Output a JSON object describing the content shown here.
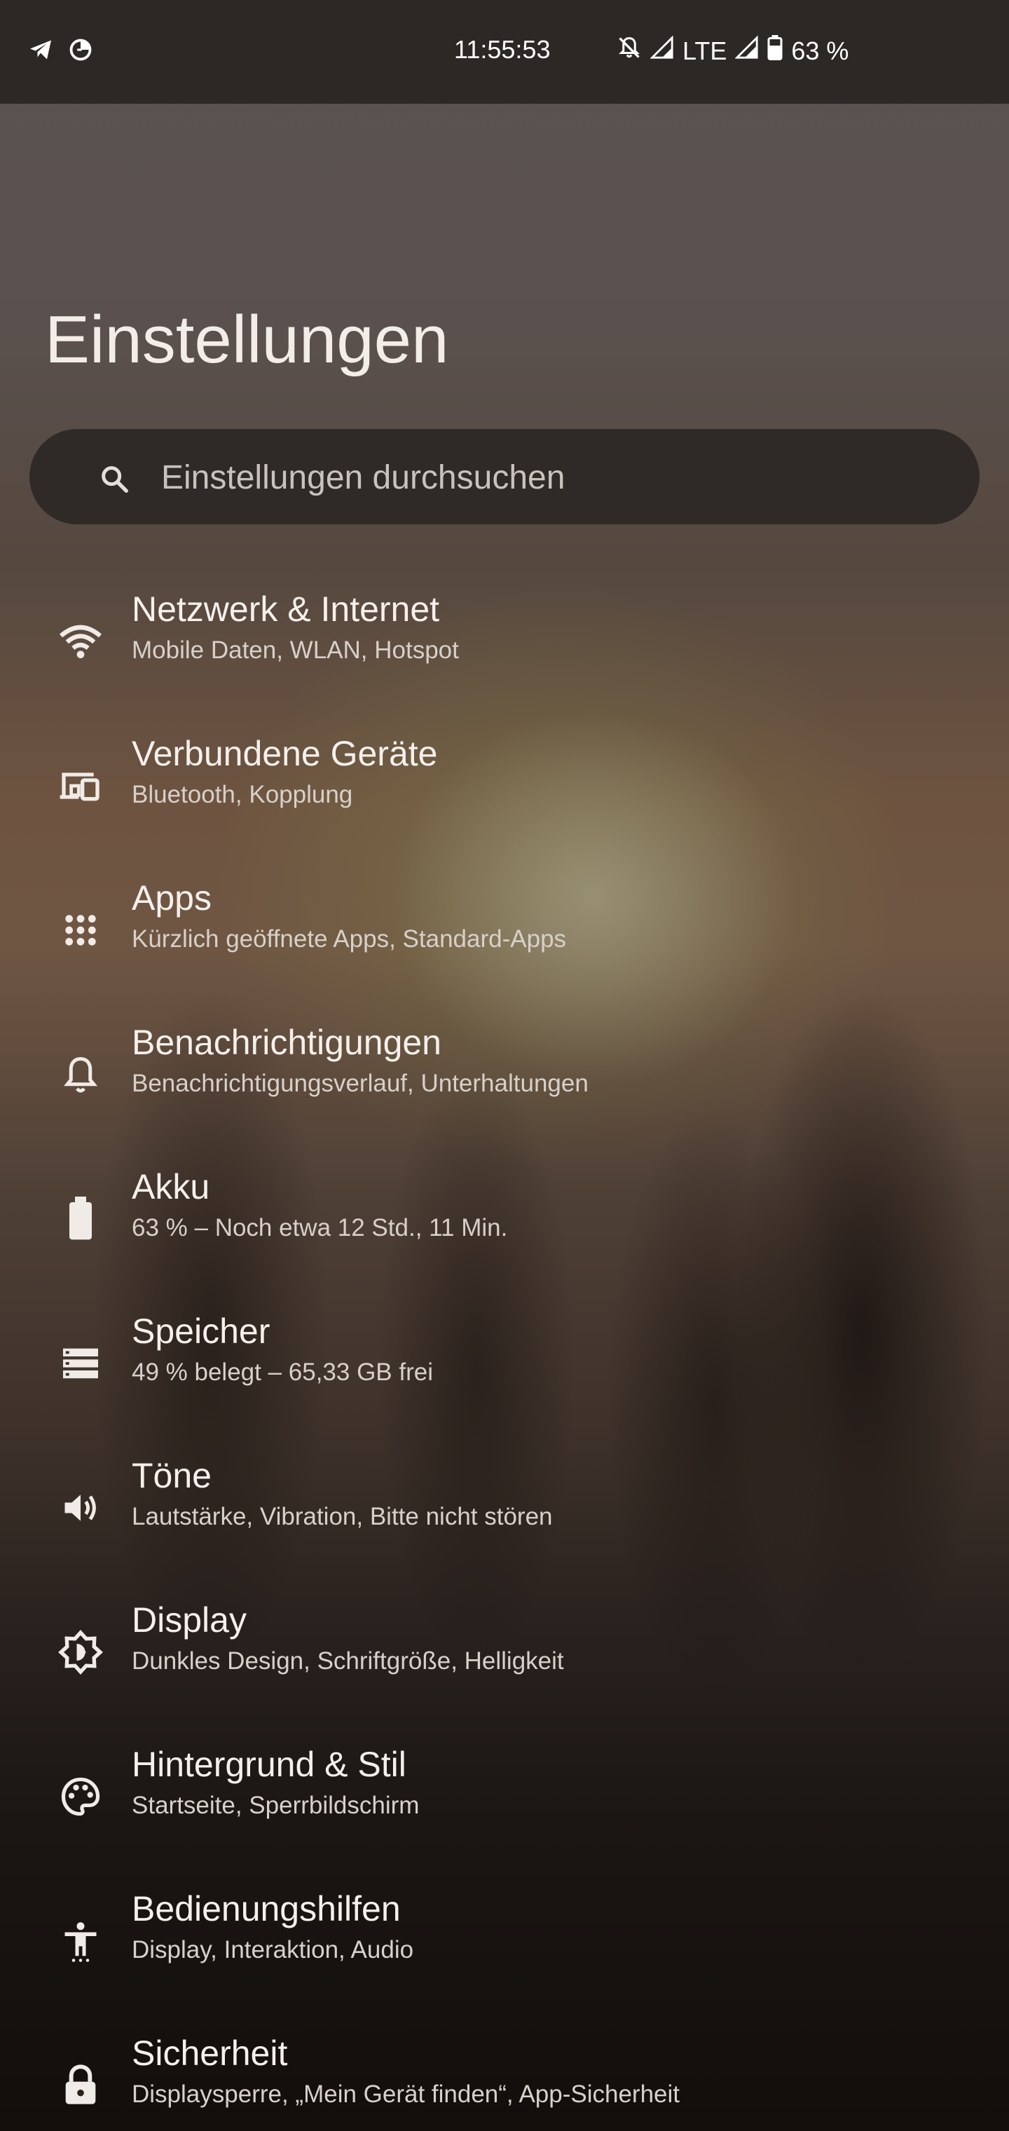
{
  "status_bar": {
    "time": "11:55:53",
    "network": "LTE",
    "battery": "63 %",
    "left_icons": [
      "telegram-icon",
      "data-saver-icon"
    ],
    "right_icons": [
      "bell-off-icon",
      "signal-icon",
      "signal-icon",
      "battery-icon"
    ]
  },
  "header": {
    "title": "Einstellungen"
  },
  "search": {
    "placeholder": "Einstellungen durchsuchen",
    "icon": "search-icon"
  },
  "settings": {
    "items": [
      {
        "title": "Netzwerk & Internet",
        "subtitle": "Mobile Daten, WLAN, Hotspot",
        "icon": "wifi-icon"
      },
      {
        "title": "Verbundene Geräte",
        "subtitle": "Bluetooth, Kopplung",
        "icon": "devices-icon"
      },
      {
        "title": "Apps",
        "subtitle": "Kürzlich geöffnete Apps, Standard-Apps",
        "icon": "apps-grid-icon"
      },
      {
        "title": "Benachrichtigungen",
        "subtitle": "Benachrichtigungsverlauf, Unterhaltungen",
        "icon": "bell-icon"
      },
      {
        "title": "Akku",
        "subtitle": "63 % – Noch etwa 12 Std., 11 Min.",
        "icon": "battery-icon"
      },
      {
        "title": "Speicher",
        "subtitle": "49 % belegt – 65,33 GB frei",
        "icon": "storage-icon"
      },
      {
        "title": "Töne",
        "subtitle": "Lautstärke, Vibration, Bitte nicht stören",
        "icon": "volume-icon"
      },
      {
        "title": "Display",
        "subtitle": "Dunkles Design, Schriftgröße, Helligkeit",
        "icon": "brightness-icon"
      },
      {
        "title": "Hintergrund & Stil",
        "subtitle": "Startseite, Sperrbildschirm",
        "icon": "palette-icon"
      },
      {
        "title": "Bedienungshilfen",
        "subtitle": "Display, Interaktion, Audio",
        "icon": "accessibility-icon"
      },
      {
        "title": "Sicherheit",
        "subtitle": "Displaysperre, „Mein Gerät finden“, App-Sicherheit",
        "icon": "lock-icon"
      }
    ]
  },
  "colors": {
    "status_bar_bg": "#2c2826",
    "text_primary": "#f5f0ec",
    "text_secondary": "#d8d0ca",
    "search_bg": "#282422"
  }
}
